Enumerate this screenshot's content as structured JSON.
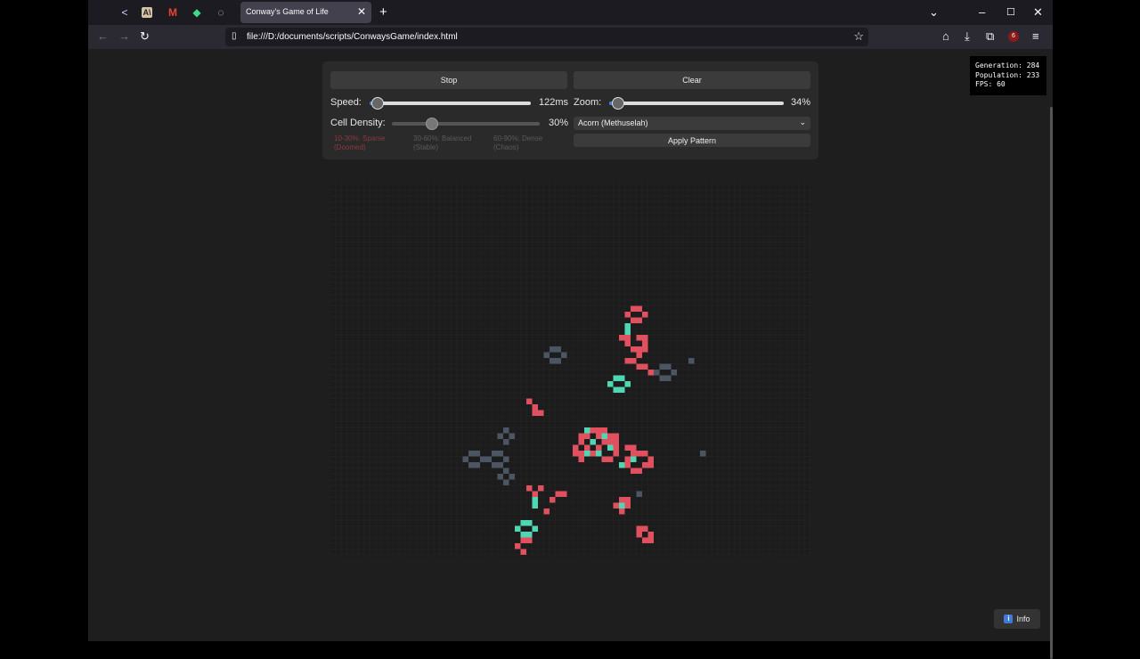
{
  "browser": {
    "tab_title": "Conway's Game of Life",
    "url": "file:///D:/documents/scripts/ConwaysGame/index.html",
    "extension_badge": "6"
  },
  "controls": {
    "stop_label": "Stop",
    "clear_label": "Clear",
    "speed_label": "Speed:",
    "speed_value": "122ms",
    "speed_fraction": 0.05,
    "zoom_label": "Zoom:",
    "zoom_value": "34%",
    "zoom_fraction": 0.05,
    "density_label": "Cell Density:",
    "density_value": "30%",
    "density_fraction": 0.27,
    "density_hints": [
      {
        "range": "10-30%: Sparse",
        "desc": "(Doomed)"
      },
      {
        "range": "30-60%: Balanced",
        "desc": "(Stable)"
      },
      {
        "range": "60-90%: Dense",
        "desc": "(Chaos)"
      }
    ],
    "pattern_selected": "Acorn (Methuselah)",
    "apply_label": "Apply Pattern"
  },
  "stats": {
    "generation": "Generation: 284",
    "population": "Population: 233",
    "fps": "FPS: 60"
  },
  "info_label": "Info",
  "colors": {
    "cell_red": "#e0505e",
    "cell_teal": "#4fd6b3",
    "cell_gray": "#4b5563",
    "grid_bg": "#1c1c1c",
    "grid_line": "#262626",
    "accent": "#3d7bd9"
  },
  "cells": {
    "red": [
      [
        52,
        21
      ],
      [
        53,
        21
      ],
      [
        51,
        22
      ],
      [
        54,
        22
      ],
      [
        52,
        23
      ],
      [
        53,
        23
      ],
      [
        50,
        26
      ],
      [
        51,
        26
      ],
      [
        53,
        26
      ],
      [
        54,
        26
      ],
      [
        51,
        27
      ],
      [
        54,
        27
      ],
      [
        52,
        28
      ],
      [
        53,
        28
      ],
      [
        54,
        28
      ],
      [
        53,
        29
      ],
      [
        51,
        30
      ],
      [
        52,
        30
      ],
      [
        53,
        31
      ],
      [
        54,
        31
      ],
      [
        55,
        32
      ],
      [
        34,
        37
      ],
      [
        35,
        38
      ],
      [
        35,
        39
      ],
      [
        36,
        39
      ],
      [
        45,
        42
      ],
      [
        46,
        42
      ],
      [
        47,
        42
      ],
      [
        43,
        43
      ],
      [
        44,
        43
      ],
      [
        46,
        43
      ],
      [
        48,
        43
      ],
      [
        49,
        43
      ],
      [
        43,
        44
      ],
      [
        47,
        44
      ],
      [
        48,
        44
      ],
      [
        49,
        44
      ],
      [
        42,
        45
      ],
      [
        44,
        45
      ],
      [
        46,
        45
      ],
      [
        49,
        45
      ],
      [
        51,
        45
      ],
      [
        52,
        45
      ],
      [
        42,
        46
      ],
      [
        43,
        46
      ],
      [
        45,
        46
      ],
      [
        49,
        46
      ],
      [
        52,
        46
      ],
      [
        53,
        46
      ],
      [
        54,
        46
      ],
      [
        43,
        47
      ],
      [
        47,
        47
      ],
      [
        48,
        47
      ],
      [
        51,
        47
      ],
      [
        55,
        47
      ],
      [
        51,
        48
      ],
      [
        54,
        48
      ],
      [
        55,
        48
      ],
      [
        52,
        49
      ],
      [
        53,
        49
      ],
      [
        34,
        52
      ],
      [
        36,
        52
      ],
      [
        35,
        53
      ],
      [
        39,
        53
      ],
      [
        40,
        53
      ],
      [
        38,
        54
      ],
      [
        50,
        54
      ],
      [
        51,
        54
      ],
      [
        49,
        55
      ],
      [
        51,
        55
      ],
      [
        37,
        56
      ],
      [
        50,
        56
      ],
      [
        53,
        59
      ],
      [
        54,
        59
      ],
      [
        53,
        60
      ],
      [
        55,
        60
      ],
      [
        54,
        61
      ],
      [
        55,
        61
      ],
      [
        33,
        61
      ],
      [
        34,
        61
      ],
      [
        32,
        62
      ],
      [
        33,
        63
      ]
    ],
    "teal": [
      [
        51,
        24
      ],
      [
        51,
        25
      ],
      [
        49,
        33
      ],
      [
        50,
        33
      ],
      [
        48,
        34
      ],
      [
        51,
        34
      ],
      [
        49,
        35
      ],
      [
        50,
        35
      ],
      [
        44,
        42
      ],
      [
        47,
        43
      ],
      [
        45,
        44
      ],
      [
        48,
        45
      ],
      [
        44,
        46
      ],
      [
        46,
        46
      ],
      [
        52,
        47
      ],
      [
        50,
        48
      ],
      [
        35,
        54
      ],
      [
        35,
        55
      ],
      [
        50,
        55
      ],
      [
        53,
        53
      ],
      [
        33,
        58
      ],
      [
        34,
        58
      ],
      [
        32,
        59
      ],
      [
        35,
        59
      ],
      [
        33,
        60
      ],
      [
        34,
        60
      ]
    ],
    "gray": [
      [
        38,
        28
      ],
      [
        39,
        28
      ],
      [
        37,
        29
      ],
      [
        40,
        29
      ],
      [
        38,
        30
      ],
      [
        39,
        30
      ],
      [
        57,
        31
      ],
      [
        58,
        31
      ],
      [
        56,
        32
      ],
      [
        59,
        32
      ],
      [
        57,
        33
      ],
      [
        58,
        33
      ],
      [
        62,
        30
      ],
      [
        30,
        42
      ],
      [
        29,
        43
      ],
      [
        31,
        43
      ],
      [
        30,
        44
      ],
      [
        24,
        46
      ],
      [
        25,
        46
      ],
      [
        23,
        47
      ],
      [
        26,
        47
      ],
      [
        24,
        48
      ],
      [
        25,
        48
      ],
      [
        28,
        46
      ],
      [
        29,
        46
      ],
      [
        28,
        48
      ],
      [
        29,
        48
      ],
      [
        27,
        47
      ],
      [
        30,
        47
      ],
      [
        30,
        49
      ],
      [
        29,
        50
      ],
      [
        31,
        50
      ],
      [
        30,
        51
      ],
      [
        64,
        46
      ],
      [
        53,
        53
      ]
    ]
  }
}
